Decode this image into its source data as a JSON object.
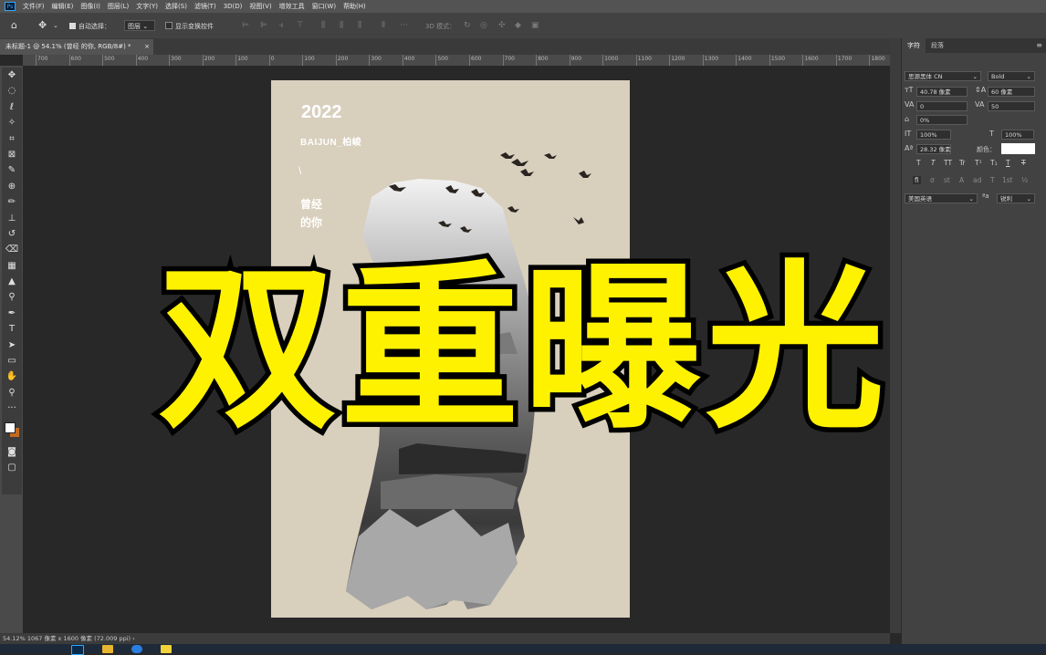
{
  "menubar": {
    "app_icon": "Ps",
    "items": [
      "文件(F)",
      "编辑(E)",
      "图像(I)",
      "图层(L)",
      "文字(Y)",
      "选择(S)",
      "滤镜(T)",
      "3D(D)",
      "视图(V)",
      "增效工具",
      "窗口(W)",
      "帮助(H)"
    ]
  },
  "options": {
    "auto_select_label": "自动选择：",
    "auto_select_value": "图层",
    "show_transform_label": "显示变换控件",
    "mode_3d_label": "3D 模式："
  },
  "document": {
    "tab_title": "未标题-1 @ 54.1% (曾经 的你, RGB/8#) *",
    "close_icon": "×"
  },
  "ruler": {
    "h_ticks": [
      "700",
      "600",
      "500",
      "400",
      "300",
      "200",
      "100",
      "0",
      "100",
      "200",
      "300",
      "400",
      "500",
      "600",
      "700",
      "800",
      "900",
      "1000",
      "1100",
      "1200",
      "1300",
      "1400",
      "1500",
      "1600",
      "1700",
      "1800"
    ]
  },
  "poster": {
    "year": "2022",
    "author": "BAIJUN_柏峻",
    "slash": "\\",
    "line1": "曾经",
    "line2": "的你",
    "bg_color": "#d8cfbd"
  },
  "overlay_title": "双重曝光",
  "panel": {
    "tabs": [
      "字符",
      "段落"
    ],
    "font_family": "思源黑体 CN",
    "font_style": "Bold",
    "font_size": "40.78 像素",
    "leading": "60 像素",
    "kerning": "0",
    "tracking": "50",
    "scale_percent": "0%",
    "vertical_scale": "100%",
    "horizontal_scale": "100%",
    "baseline_shift": "28.32 像素",
    "color_label": "颜色：",
    "style_buttons": [
      "T",
      "T",
      "TT",
      "Tr",
      "T¹",
      "T₁",
      "T",
      "T"
    ],
    "opentype_buttons": [
      "fi",
      "σ",
      "st",
      "A",
      "ad",
      "T",
      "1st",
      "½"
    ],
    "language": "美国英语",
    "anti_alias": "锐利"
  },
  "status": {
    "text": "54.12%   1067 像素 x 1600 像素 (72.009 ppi)   ›"
  },
  "colors": {
    "accent": "#fff200",
    "menubar": "#535353",
    "panel": "#424242"
  }
}
